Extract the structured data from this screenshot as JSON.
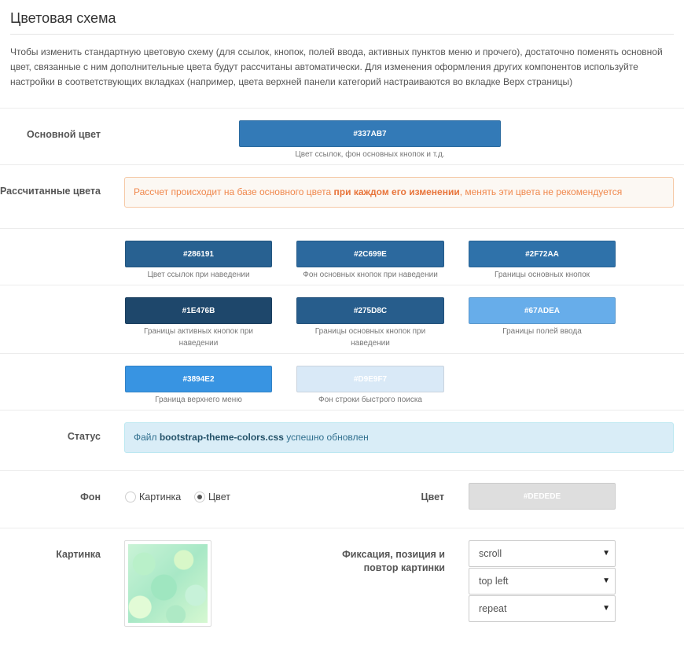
{
  "header": {
    "title": "Цветовая схема",
    "intro": "Чтобы изменить стандартную цветовую схему (для ссылок, кнопок, полей ввода, активных пунктов меню и прочего), достаточно поменять основной цвет, связанные с ним дополнительные цвета будут рассчитаны автоматически. Для изменения оформления других компонентов используйте настройки в соответствующих вкладках (например, цвета верхней панели категорий настраиваются во вкладке Верх страницы)"
  },
  "main_color": {
    "label": "Основной цвет",
    "value": "#337AB7",
    "caption": "Цвет ссылок, фон основных кнопок и т.д."
  },
  "computed": {
    "label": "Рассчитанные цвета",
    "warning_prefix": "Рассчет происходит на базе основного цвета ",
    "warning_bold": "при каждом его изменении",
    "warning_suffix": ", менять эти цвета не рекомендуется",
    "swatches": [
      {
        "value": "#286191",
        "caption": "Цвет ссылок при наведении"
      },
      {
        "value": "#2C699E",
        "caption": "Фон основных кнопок при наведении"
      },
      {
        "value": "#2F72AA",
        "caption": "Границы основных кнопок"
      },
      {
        "value": "#1E476B",
        "caption": "Границы активных кнопок при наведении"
      },
      {
        "value": "#275D8C",
        "caption": "Границы основных кнопок при наведении"
      },
      {
        "value": "#67ADEA",
        "caption": "Границы полей ввода"
      },
      {
        "value": "#3894E2",
        "caption": "Граница верхнего меню"
      },
      {
        "value": "#D9E9F7",
        "caption": "Фон строки быстрого поиска"
      }
    ]
  },
  "status": {
    "label": "Статус",
    "prefix": "Файл ",
    "filename": "bootstrap-theme-colors.css",
    "suffix": " успешно обновлен"
  },
  "background": {
    "label": "Фон",
    "option_image": "Картинка",
    "option_color": "Цвет",
    "selected": "Цвет",
    "color_label": "Цвет",
    "color_value": "#DEDEDE"
  },
  "picture": {
    "label": "Картинка",
    "fix_label": "Фиксация, позиция и повтор картинки",
    "attachment": "scroll",
    "position": "top left",
    "repeat": "repeat"
  }
}
